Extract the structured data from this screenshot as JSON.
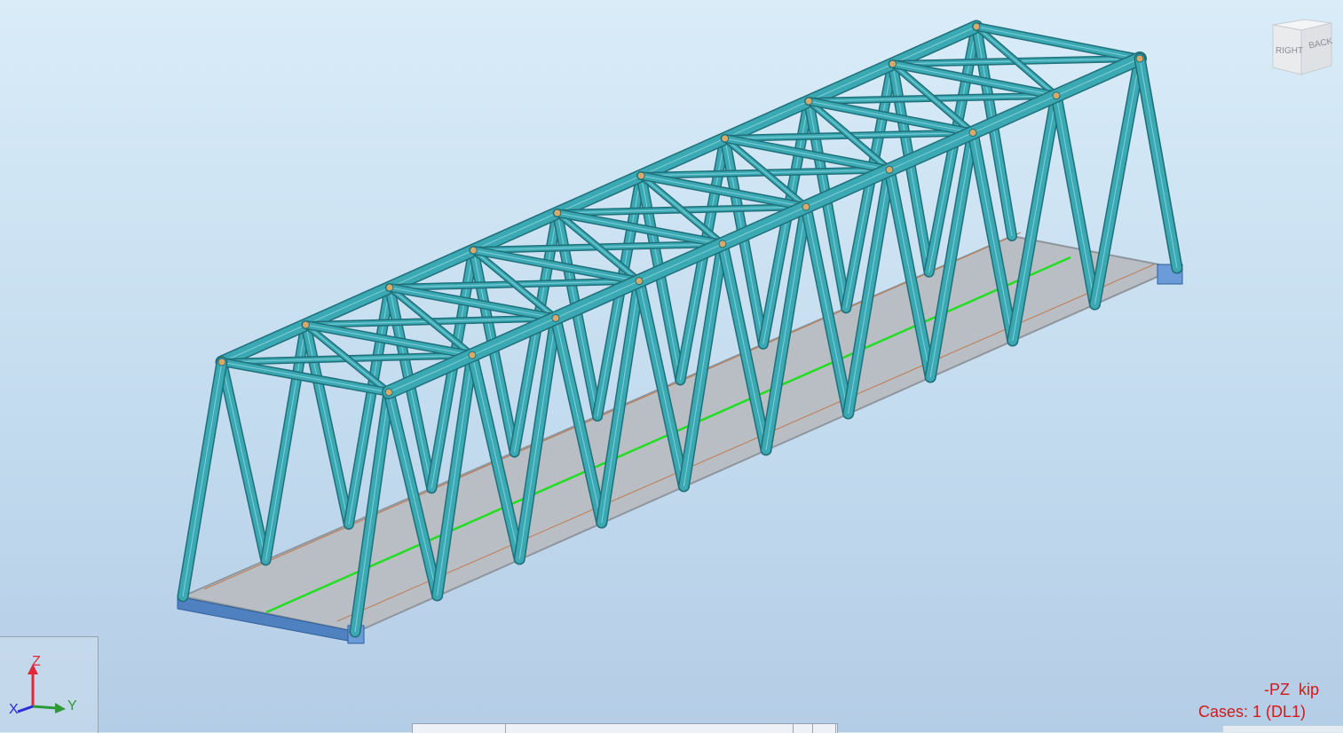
{
  "viewport": {
    "model": "steel truss bridge",
    "colors": {
      "background_top": "#d9ecf8",
      "background_bottom": "#b4cde6",
      "member": "#3aa9b4",
      "member_edge": "#1f6f78",
      "deck": "#b9bec4",
      "deck_edge": "#8e959c",
      "support": "#4f80c0",
      "centerline": "#22dd22"
    }
  },
  "viewcube": {
    "face_right": "RIGHT",
    "face_back": "BACK"
  },
  "axis_triad": {
    "z_label": "Z",
    "y_label": "Y",
    "x_label": "X",
    "z_color": "#e0283a",
    "y_color": "#2d9a3a",
    "x_color": "#2a2ad8"
  },
  "result_info": {
    "units": "-PZ  kip",
    "cases": "Cases: 1 (DL1)",
    "color": "#d11a1a"
  }
}
